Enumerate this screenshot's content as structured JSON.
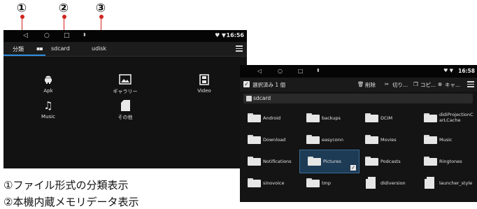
{
  "callouts": [
    "①",
    "②",
    "③"
  ],
  "screen1": {
    "status": {
      "back": "◁",
      "home": "○",
      "recents": "□",
      "usb": "⬍",
      "signal": "♥ ▼",
      "time": "16:56"
    },
    "tabs": {
      "category": "分類",
      "sdcard": "sdcard",
      "udisk": "udisk"
    },
    "categories": [
      {
        "label": "Apk",
        "icon": "android-icon"
      },
      {
        "label": "ギャラリー",
        "icon": "image-icon"
      },
      {
        "label": "Video",
        "icon": "film-icon"
      },
      {
        "label": "Music",
        "icon": "music-note-icon"
      },
      {
        "label": "その他",
        "icon": "file-icon"
      }
    ]
  },
  "screen2": {
    "status": {
      "back": "◁",
      "home": "○",
      "recents": "□",
      "usb": "⬍",
      "signal": "♥ ▼",
      "time": "16:58"
    },
    "toolbar": {
      "selected": "選択済み 1 個",
      "delete": "削除",
      "cut": "切り...",
      "copy": "コピ...",
      "cancel": "キャ..."
    },
    "path": "sdcard",
    "items": [
      {
        "name": "Android",
        "type": "folder"
      },
      {
        "name": "backups",
        "type": "folder"
      },
      {
        "name": "DCIM",
        "type": "folder"
      },
      {
        "name": "didiProjectionCarLCache",
        "type": "folder"
      },
      {
        "name": "Download",
        "type": "folder"
      },
      {
        "name": "easyconn",
        "type": "folder"
      },
      {
        "name": "Movies",
        "type": "folder"
      },
      {
        "name": "Music",
        "type": "folder"
      },
      {
        "name": "Notifications",
        "type": "folder"
      },
      {
        "name": "Pictures",
        "type": "folder",
        "selected": true
      },
      {
        "name": "Podcasts",
        "type": "folder"
      },
      {
        "name": "Ringtones",
        "type": "folder"
      },
      {
        "name": "sinovoice",
        "type": "folder"
      },
      {
        "name": "tmp",
        "type": "folder"
      },
      {
        "name": "didiversion",
        "type": "file"
      },
      {
        "name": "launcher_style",
        "type": "file"
      }
    ]
  },
  "caption": {
    "line1": "①ファイル形式の分類表示",
    "line2": "②本機内蔵メモリデータ表示"
  },
  "colors": {
    "accent": "#2f8fe0",
    "callout_line": "#d0251e",
    "selected_bg": "#1d3b55"
  }
}
